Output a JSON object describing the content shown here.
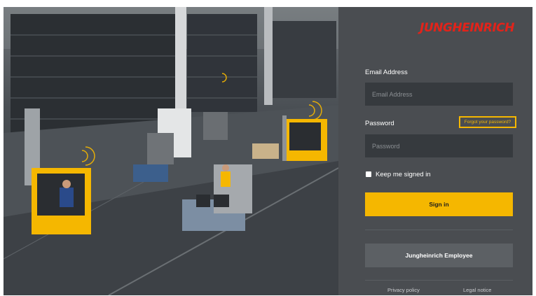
{
  "brand": {
    "logo_text": "JUNGHEINRICH",
    "accent": "#f5b700",
    "logo_color": "#e2231a"
  },
  "hero": {
    "description_icon": "warehouse-forklift-photo"
  },
  "form": {
    "email_label": "Email Address",
    "email_placeholder": "Email Address",
    "password_label": "Password",
    "password_placeholder": "Password",
    "forgot_label": "Forgot your password?",
    "keep_signed_in_label": "Keep me signed in",
    "keep_signed_in_checked": false,
    "sign_in_label": "Sign in",
    "employee_label": "Jungheinrich Employee"
  },
  "footer": {
    "privacy_label": "Privacy policy",
    "legal_label": "Legal notice"
  }
}
